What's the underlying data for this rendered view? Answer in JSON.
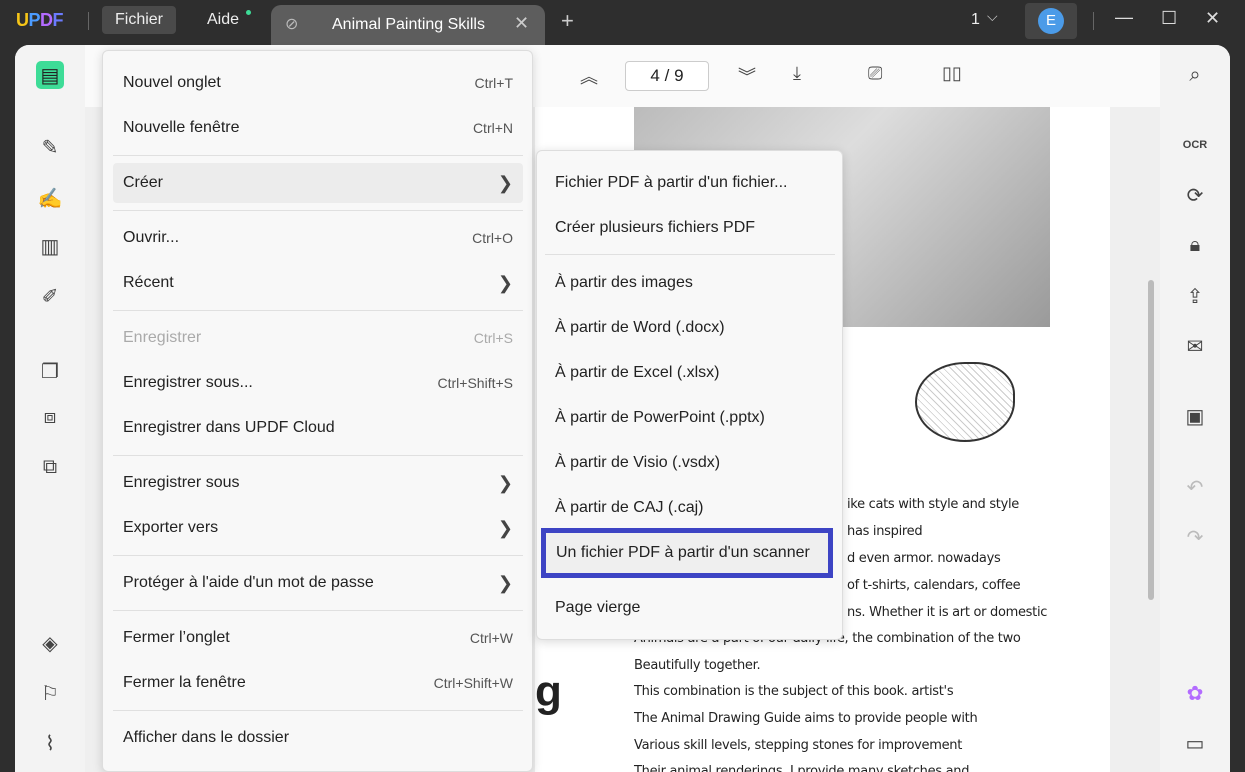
{
  "titlebar": {
    "logo": "UPDF",
    "menu_file": "Fichier",
    "menu_help": "Aide",
    "tab_title": "Animal Painting Skills",
    "page_count_label": "1",
    "avatar": "E"
  },
  "toolbar": {
    "page_current": "4",
    "page_sep": "/",
    "page_total": "9"
  },
  "file_menu": {
    "items": [
      {
        "label": "Nouvel onglet",
        "shortcut": "Ctrl+T"
      },
      {
        "label": "Nouvelle fenêtre",
        "shortcut": "Ctrl+N"
      },
      {
        "label": "Créer",
        "shortcut": ""
      },
      {
        "label": "Ouvrir...",
        "shortcut": "Ctrl+O"
      },
      {
        "label": "Récent",
        "shortcut": ""
      },
      {
        "label": "Enregistrer",
        "shortcut": "Ctrl+S"
      },
      {
        "label": "Enregistrer sous...",
        "shortcut": "Ctrl+Shift+S"
      },
      {
        "label": "Enregistrer dans UPDF Cloud",
        "shortcut": ""
      },
      {
        "label": "Enregistrer sous",
        "shortcut": ""
      },
      {
        "label": "Exporter vers",
        "shortcut": ""
      },
      {
        "label": "Protéger à l'aide d'un mot de passe",
        "shortcut": ""
      },
      {
        "label": "Fermer l’onglet",
        "shortcut": "Ctrl+W"
      },
      {
        "label": "Fermer la fenêtre",
        "shortcut": "Ctrl+Shift+W"
      },
      {
        "label": "Afficher dans le dossier",
        "shortcut": ""
      }
    ]
  },
  "create_submenu": {
    "items": [
      "Fichier PDF à partir d'un fichier...",
      "Créer plusieurs fichiers PDF",
      "À partir des images",
      "À partir de Word (.docx)",
      "À partir de Excel (.xlsx)",
      "À partir de PowerPoint (.pptx)",
      "À partir de Visio (.vsdx)",
      "À partir de CAJ (.caj)",
      "Un fichier PDF à partir d'un scanner",
      "Page vierge"
    ]
  },
  "document": {
    "lines": [
      "ike cats with style and style",
      "has inspired",
      "d even armor. nowadays",
      "of t-shirts, calendars, coffee",
      "ns. Whether it is art or domestic",
      "Animals are a part of our daily life, the combination of the two",
      "Beautifully together.",
      "This combination is the subject of this book. artist's",
      "The Animal Drawing Guide aims to provide people with",
      "Various skill levels, stepping stones for improvement",
      "Their animal renderings. I provide many sketches and"
    ],
    "heading_fragment": "g"
  },
  "colors": {
    "accent": "#3d44c4",
    "logo_green": "#3ddc97"
  }
}
